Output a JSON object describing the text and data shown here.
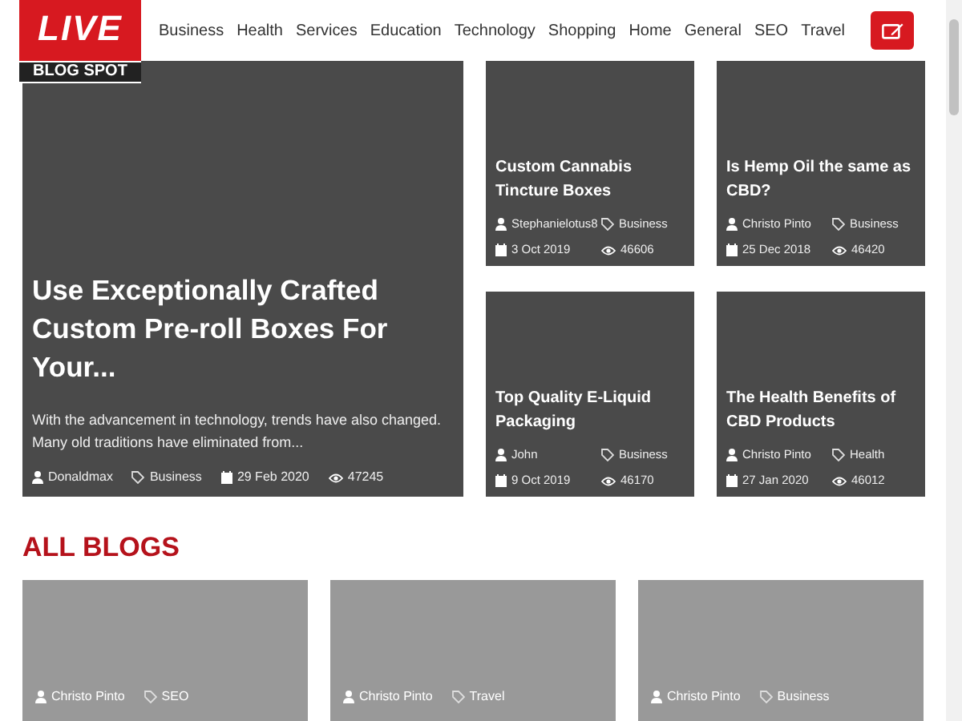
{
  "header": {
    "logo": {
      "top": "LIVE",
      "bottom": "BLOG SPOT"
    },
    "nav": [
      {
        "label": "Business"
      },
      {
        "label": "Health"
      },
      {
        "label": "Services"
      },
      {
        "label": "Education"
      },
      {
        "label": "Technology"
      },
      {
        "label": "Shopping"
      },
      {
        "label": "Home"
      },
      {
        "label": "General"
      },
      {
        "label": "SEO"
      },
      {
        "label": "Travel"
      }
    ]
  },
  "featured": {
    "title": "Use Exceptionally Crafted Custom Pre-roll Boxes For Your...",
    "excerpt": "With the advancement in technology, trends have also changed. Many old traditions have eliminated from...",
    "author": "Donaldmax",
    "category": "Business",
    "date": "29 Feb 2020",
    "views": "47245"
  },
  "side_posts": [
    {
      "title": "Custom Cannabis Tincture Boxes",
      "author": "Stephanielotus8",
      "category": "Business",
      "date": "3 Oct 2019",
      "views": "46606"
    },
    {
      "title": "Is Hemp Oil the same as CBD?",
      "author": "Christo Pinto",
      "category": "Business",
      "date": "25 Dec 2018",
      "views": "46420"
    },
    {
      "title": "Top Quality E-Liquid Packaging",
      "author": "John",
      "category": "Business",
      "date": "9 Oct 2019",
      "views": "46170"
    },
    {
      "title": "The Health Benefits of CBD Products",
      "author": "Christo Pinto",
      "category": "Health",
      "date": "27 Jan 2020",
      "views": "46012"
    }
  ],
  "all_blogs": {
    "heading": "ALL BLOGS",
    "posts": [
      {
        "author": "Christo Pinto",
        "category": "SEO"
      },
      {
        "author": "Christo Pinto",
        "category": "Travel"
      },
      {
        "author": "Christo Pinto",
        "category": "Business"
      }
    ]
  }
}
